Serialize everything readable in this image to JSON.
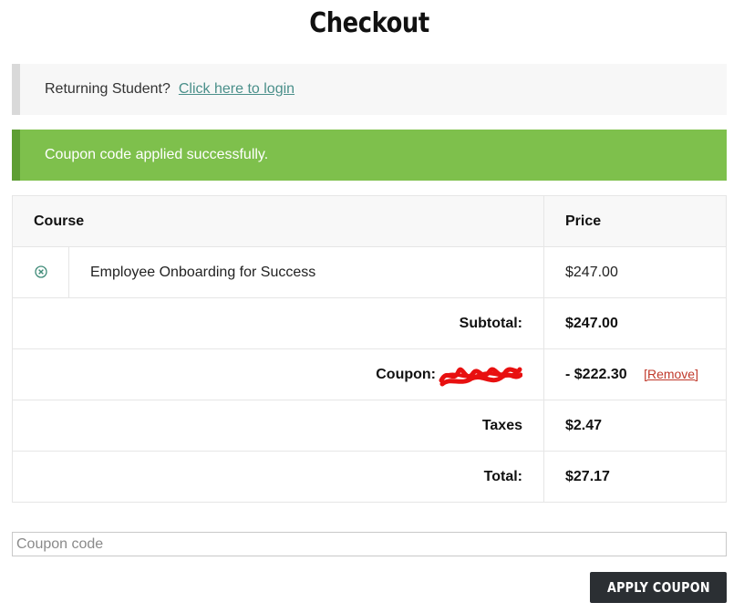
{
  "page": {
    "title": "Checkout"
  },
  "login_notice": {
    "text": "Returning Student?",
    "link_label": "Click here to login"
  },
  "success_notice": {
    "text": "Coupon code applied successfully."
  },
  "cart_table": {
    "headers": {
      "course": "Course",
      "price": "Price"
    },
    "items": [
      {
        "name": "Employee Onboarding for Success",
        "price": "$247.00"
      }
    ],
    "subtotal": {
      "label": "Subtotal:",
      "value": "$247.00"
    },
    "coupon": {
      "label": "Coupon:",
      "value": "- $222.30",
      "remove_label": "[Remove]"
    },
    "taxes": {
      "label": "Taxes",
      "value": "$2.47"
    },
    "total": {
      "label": "Total:",
      "value": "$27.17"
    }
  },
  "coupon_form": {
    "placeholder": "Coupon code",
    "value": "",
    "button_label": "APPLY COUPON"
  },
  "colors": {
    "success_bg": "#7ec04c",
    "link": "#4a8f8a",
    "remove_link": "#c0392b",
    "button_bg": "#2b2f33",
    "redaction": "#e81010"
  },
  "icons": {
    "remove_item": "circle-x-icon",
    "coupon_redaction": "redaction-scribble"
  }
}
